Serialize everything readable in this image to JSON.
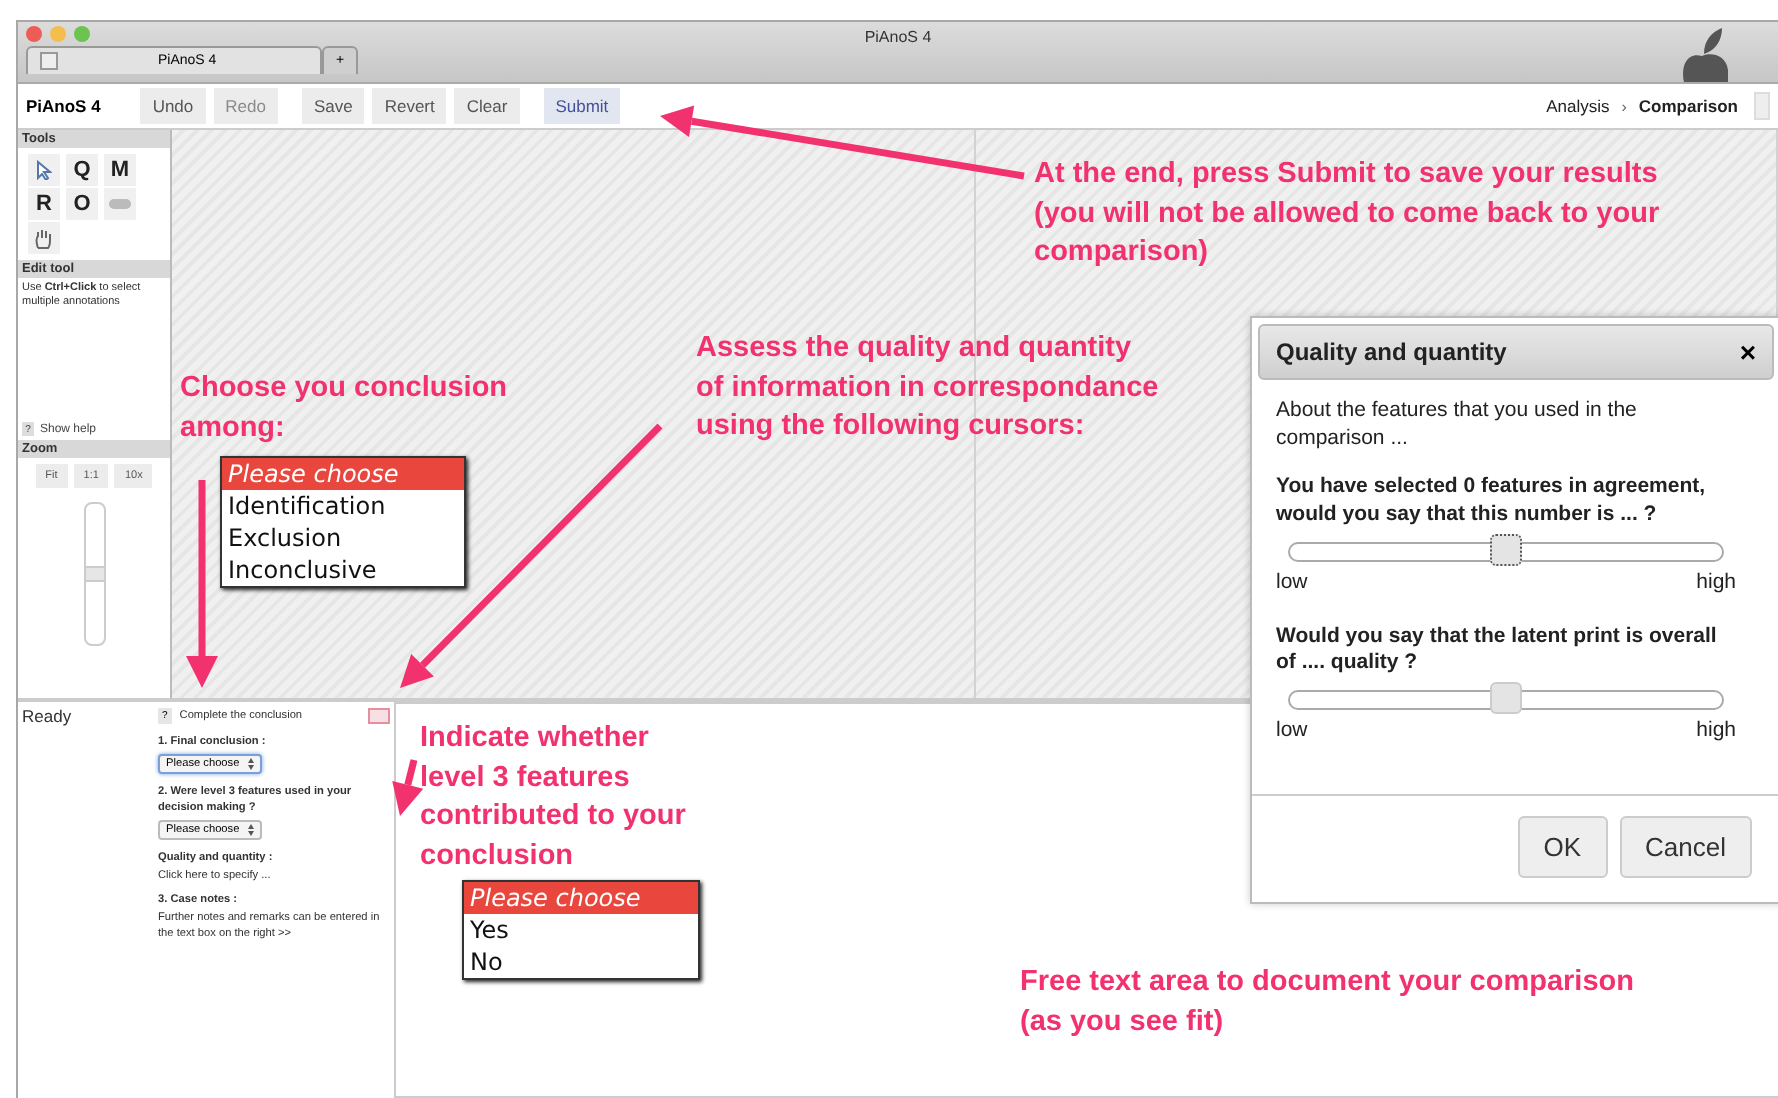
{
  "window": {
    "title": "PiAnoS 4",
    "tabs": [
      {
        "label": "PiAnoS 4",
        "selected": true
      },
      {
        "label": "+",
        "selected": false
      }
    ]
  },
  "toolbar": {
    "app_name": "PiAnoS 4",
    "buttons": [
      {
        "label": "Undo",
        "disabled": false,
        "primary": false
      },
      {
        "label": "Redo",
        "disabled": true,
        "primary": false
      },
      {
        "label": "Save",
        "disabled": false,
        "primary": false
      },
      {
        "label": "Revert",
        "disabled": false,
        "primary": false
      },
      {
        "label": "Clear",
        "disabled": false,
        "primary": false
      },
      {
        "label": "Submit",
        "disabled": false,
        "primary": true
      }
    ],
    "breadcrumb": [
      {
        "label": "Analysis",
        "selected": false
      },
      {
        "label": "Comparison",
        "selected": true
      }
    ],
    "separator": "›"
  },
  "tools_panel": {
    "title": "Tools",
    "tools": [
      "Q",
      "M",
      "R",
      "O"
    ]
  },
  "edit_tool": {
    "title": "Edit tool",
    "text": "Use **Ctrl+Click** to select multiple annotations",
    "help_key": "?",
    "help": "Show help"
  },
  "zoom": {
    "title": "Zoom",
    "buttons": [
      "Fit",
      "1:1",
      "10x"
    ],
    "level": 0.5
  },
  "status": "Ready",
  "conclusion_form": {
    "help_key": "?",
    "header": "Complete the conclusion",
    "sections": [
      {
        "kind": "select",
        "title": "1. Final conclusion :",
        "value": "Please choose",
        "focused": true
      },
      {
        "kind": "select",
        "title": "2. Were level 3 features used in your decision making ?",
        "value": "Please choose",
        "focused": false
      },
      {
        "kind": "link",
        "title": "Quality and quantity :",
        "value": "Click here to specify ..."
      },
      {
        "kind": "note",
        "title": "3. Case notes :",
        "value": "Further notes and remarks can be entered in the text box on the right >>"
      }
    ]
  },
  "dialog": {
    "title": "Quality and quantity",
    "close": "×",
    "intro": "About the features that you used in the comparison ...",
    "sliders": [
      {
        "question": "You have selected 0 features in agreement, would you say that this number is ... ?",
        "level": 0.5,
        "focused": true,
        "min_label": "low",
        "max_label": "high"
      },
      {
        "question": "Would you say that the latent print is overall of .... quality ?",
        "level": 0.5,
        "focused": false,
        "min_label": "low",
        "max_label": "high"
      }
    ],
    "buttons": [
      "OK",
      "Cancel"
    ]
  },
  "dropdowns": [
    {
      "options": [
        {
          "label": "Please choose",
          "selected": true
        },
        {
          "label": "Identification",
          "selected": false
        },
        {
          "label": "Exclusion",
          "selected": false
        },
        {
          "label": "Inconclusive",
          "selected": false
        }
      ]
    },
    {
      "options": [
        {
          "label": "Please choose",
          "selected": true
        },
        {
          "label": "Yes",
          "selected": false
        },
        {
          "label": "No",
          "selected": false
        }
      ]
    }
  ],
  "annotations": [
    "At the end, press Submit to save your results\n(you will not be allowed to come back to your\ncomparison)",
    "Choose you conclusion\namong:",
    "Assess the quality and quantity\nof information in correspondance\nusing the following cursors:",
    "Indicate whether\nlevel 3 features\ncontributed to your\nconclusion",
    "Free text area to document your comparison\n(as you see fit)"
  ]
}
